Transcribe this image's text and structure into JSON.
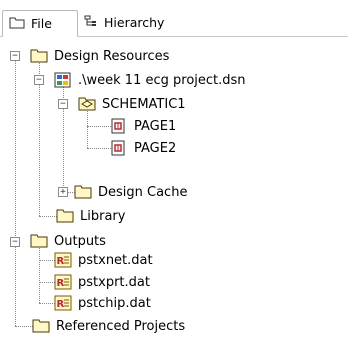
{
  "tabs": [
    {
      "label": "File",
      "icon": "folder-icon"
    },
    {
      "label": "Hierarchy",
      "icon": "hierarchy-icon"
    }
  ],
  "tree": {
    "design_resources": "Design Resources",
    "dsn_file": ".\\week 11 ecg project.dsn",
    "schematic": "SCHEMATIC1",
    "page1": "PAGE1",
    "page2": "PAGE2",
    "design_cache": "Design Cache",
    "library": "Library",
    "outputs": "Outputs",
    "out1": "pstxnet.dat",
    "out2": "pstxprt.dat",
    "out3": "pstchip.dat",
    "referenced": "Referenced Projects"
  },
  "colors": {
    "folder_fill": "#fff8c6",
    "folder_stroke": "#5a4a00",
    "file_red": "#c0272d"
  }
}
